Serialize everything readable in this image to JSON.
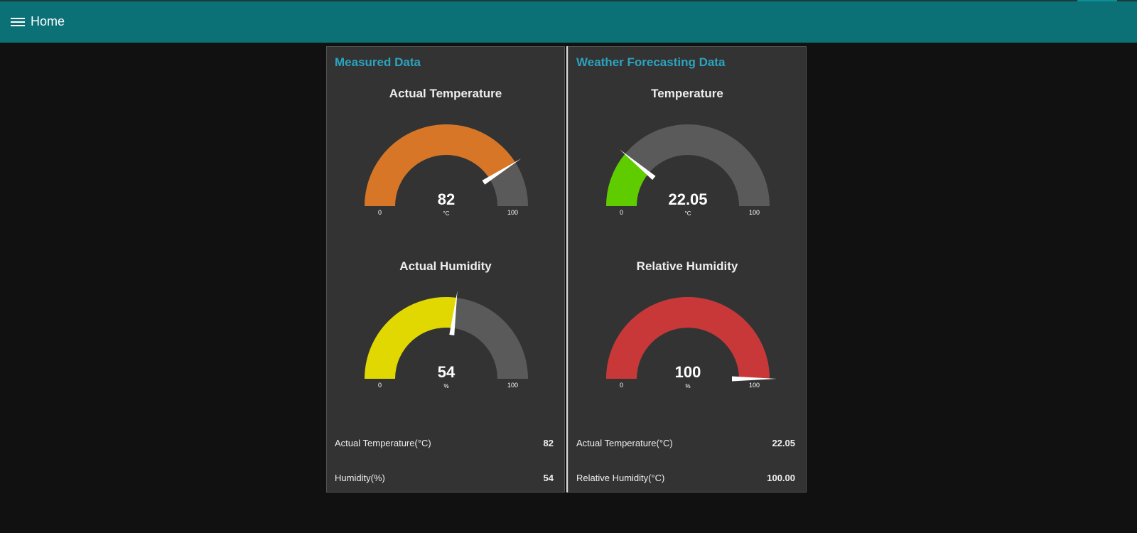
{
  "header": {
    "title": "Home",
    "menu_icon": "hamburger-menu-icon",
    "bar_color": "#0b7177"
  },
  "groups": [
    {
      "title": "Measured Data",
      "title_color": "#2ba4c0",
      "gauges": [
        {
          "title": "Actual Temperature",
          "value": "82",
          "value_num": 82,
          "unit": "°C",
          "min": "0",
          "max": "100",
          "min_num": 0,
          "max_num": 100,
          "color": "#d67626"
        },
        {
          "title": "Actual Humidity",
          "value": "54",
          "value_num": 54,
          "unit": "%",
          "min": "0",
          "max": "100",
          "min_num": 0,
          "max_num": 100,
          "color": "#e0d800"
        }
      ],
      "rows": [
        {
          "label": "Actual Temperature(°C)",
          "value": "82"
        },
        {
          "label": "Humidity(%)",
          "value": "54"
        }
      ]
    },
    {
      "title": "Weather Forecasting Data",
      "title_color": "#2ba4c0",
      "gauges": [
        {
          "title": "Temperature",
          "value": "22.05",
          "value_num": 22.05,
          "unit": "°C",
          "min": "0",
          "max": "100",
          "min_num": 0,
          "max_num": 100,
          "color": "#5fcc00"
        },
        {
          "title": "Relative Humidity",
          "value": "100",
          "value_num": 100,
          "unit": "%",
          "min": "0",
          "max": "100",
          "min_num": 0,
          "max_num": 100,
          "color": "#c83838"
        }
      ],
      "rows": [
        {
          "label": "Actual Temperature(°C)",
          "value": "22.05"
        },
        {
          "label": "Relative Humidity(°C)",
          "value": "100.00"
        }
      ]
    }
  ],
  "gauge_track_color": "#5a5a5a"
}
